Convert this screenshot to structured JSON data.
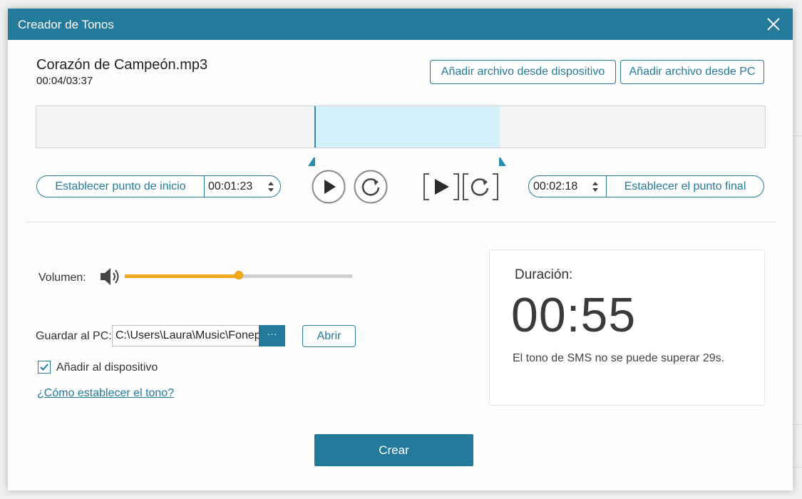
{
  "window": {
    "title": "Creador de Tonos"
  },
  "file": {
    "name": "Corazón de Campeón.mp3",
    "time": "00:04/03:37"
  },
  "buttons": {
    "add_from_device": "Añadir archivo desde dispositivo",
    "add_from_pc": "Añadir archivo desde PC",
    "set_start": "Establecer punto de inicio",
    "set_end": "Establecer el punto final",
    "open": "Abrir",
    "browse": "···",
    "create": "Crear"
  },
  "trim": {
    "start_time": "00:01:23",
    "end_time": "00:02:18"
  },
  "volume": {
    "label": "Volumen:",
    "level": 0.5
  },
  "save": {
    "label": "Guardar al PC:",
    "path": "C:\\Users\\Laura\\Music\\Fonepaw"
  },
  "add_to_device": {
    "label": "Añadir al dispositivo",
    "checked": true
  },
  "help_link": "¿Cómo establecer el tono?",
  "duration": {
    "label": "Duración:",
    "value": "00:55",
    "note": "El tono de SMS no se puede superar 29s."
  },
  "colors": {
    "accent": "#237a9b",
    "slider": "#f4a917",
    "selection": "#d4f0fb"
  },
  "icons": [
    "close-icon",
    "play-icon",
    "replay-icon",
    "play-selection-icon",
    "replay-selection-icon",
    "volume-icon",
    "checkmark-icon",
    "spinner-arrows-icon"
  ]
}
